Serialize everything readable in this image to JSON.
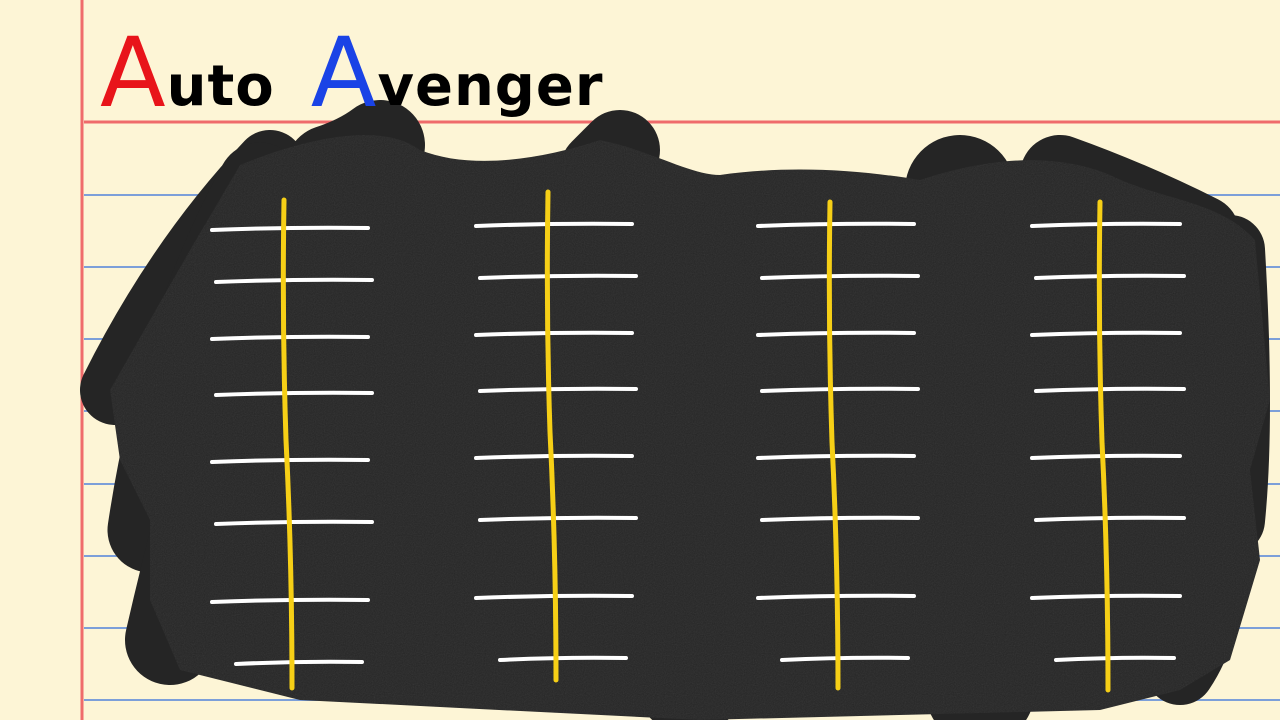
{
  "title": {
    "word1_initial": "A",
    "word1_rest": "uto",
    "word2_initial": "A",
    "word2_rest": "venger"
  },
  "colors": {
    "paper": "#fdf5d6",
    "margin_line": "#ef6b6b",
    "rule_line": "#7c9fd9",
    "road": "#252525",
    "lane_center": "#f6cf16",
    "lane_marks": "#ffffff",
    "title_first_initial": "#e8141a",
    "title_second_initial": "#1a43e6"
  },
  "road": {
    "lane_count": 4,
    "rungs_per_lane": 8
  }
}
